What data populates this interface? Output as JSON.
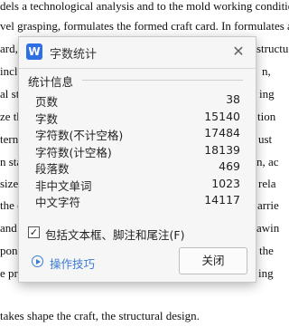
{
  "document": {
    "lines": [
      "dels a technological analysis and to the mold working conditio",
      "vel grasping, formulates the formed craft card. In formulates af",
      "ard, s",
      "inclu",
      "al st",
      "ze th",
      "terns",
      "n sta",
      "size",
      "the c",
      "and t",
      "pone",
      "e pro",
      "takes shape the craft, the structural design."
    ],
    "right_fragments": [
      "structu",
      "n,",
      "ing",
      "tion",
      "ust",
      "n, ac",
      "rela",
      "arrie",
      "awin",
      "the",
      "ing"
    ]
  },
  "dialog": {
    "title": "字数统计",
    "app_icon_letter": "W",
    "close_glyph": "✕",
    "section_title": "统计信息",
    "stats": [
      {
        "label": "页数",
        "value": "38"
      },
      {
        "label": "字数",
        "value": "15140"
      },
      {
        "label": "字符数(不计空格)",
        "value": "17484"
      },
      {
        "label": "字符数(计空格)",
        "value": "18139"
      },
      {
        "label": "段落数",
        "value": "469"
      },
      {
        "label": "非中文单词",
        "value": "1023"
      },
      {
        "label": "中文字符",
        "value": "14117"
      }
    ],
    "checkbox": {
      "label": "包括文本框、脚注和尾注(F)",
      "checked": true,
      "mark": "✓"
    },
    "tips_link": "操作技巧",
    "close_button": "关闭"
  },
  "colors": {
    "accent": "#3a7bd5",
    "app_icon": "#2f6fe4"
  },
  "icons": {
    "app": "wps-writer-icon",
    "close": "close-icon",
    "tips": "play-circle-icon",
    "check": "checkmark-icon"
  }
}
